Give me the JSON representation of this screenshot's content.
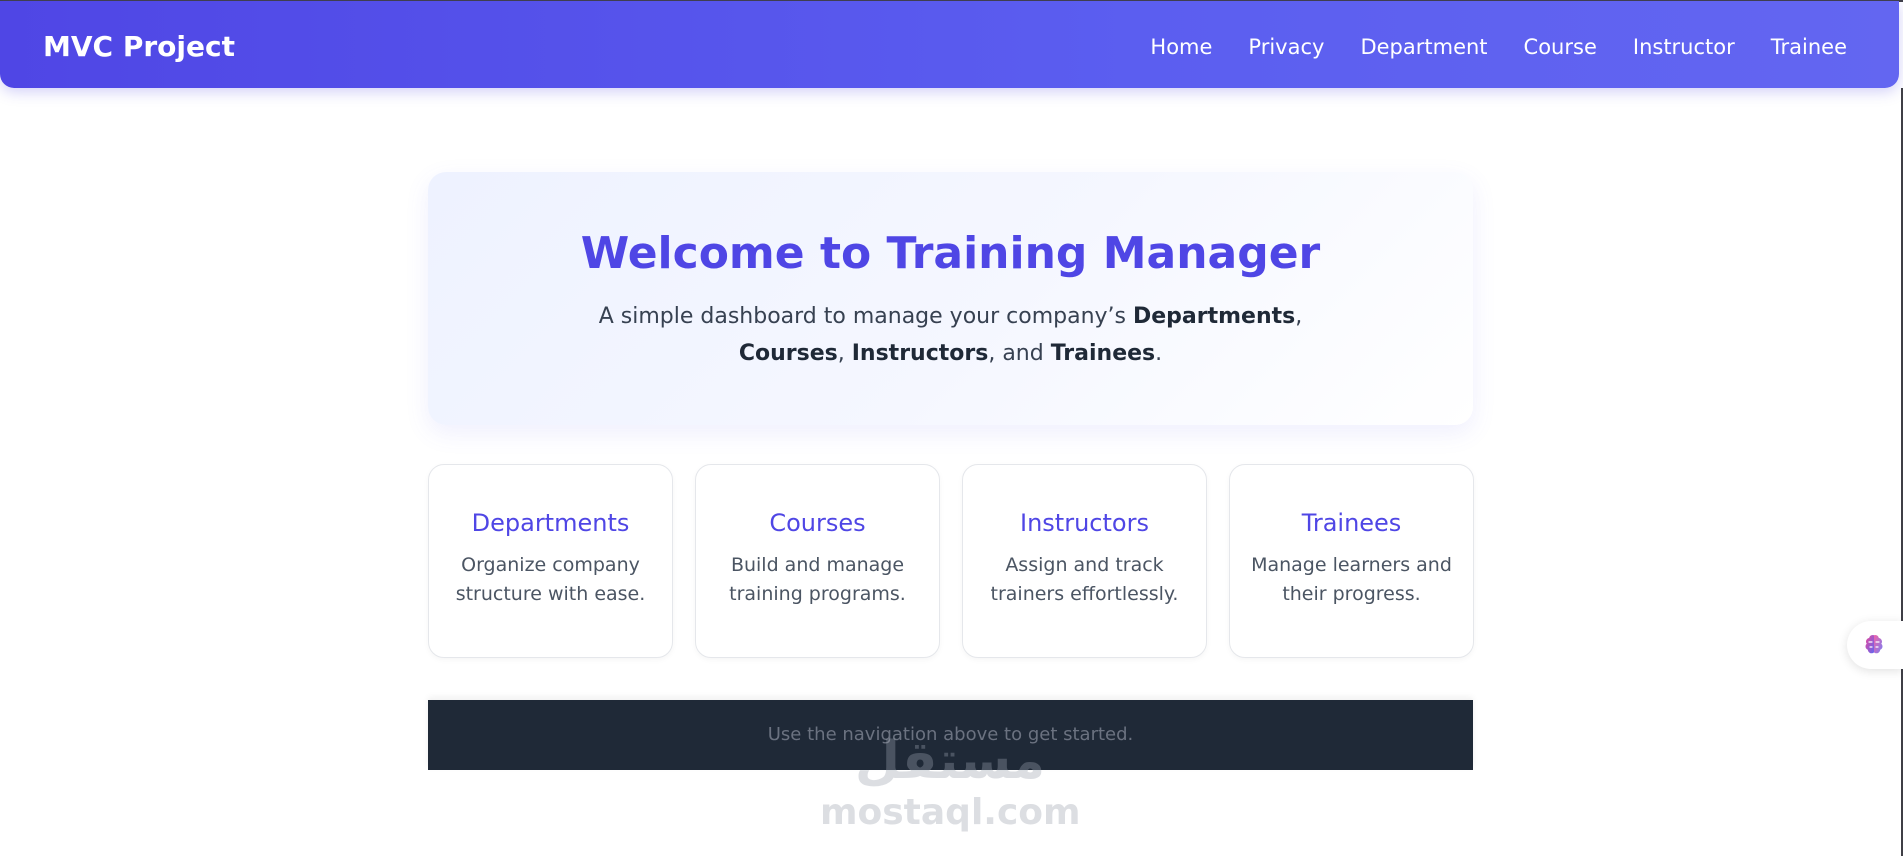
{
  "navbar": {
    "brand": "MVC Project",
    "links": [
      "Home",
      "Privacy",
      "Department",
      "Course",
      "Instructor",
      "Trainee"
    ]
  },
  "hero": {
    "title": "Welcome to Training Manager",
    "text_prefix": "A simple dashboard to manage your company’s ",
    "departments": "Departments",
    "sep1": ", ",
    "courses": "Courses",
    "sep2": ", ",
    "instructors": "Instructors",
    "sep3": ", and ",
    "trainees": "Trainees",
    "suffix": "."
  },
  "cards": [
    {
      "title": "Departments",
      "description": "Organize company structure with ease."
    },
    {
      "title": "Courses",
      "description": "Build and manage training programs."
    },
    {
      "title": "Instructors",
      "description": "Assign and track trainers effortlessly."
    },
    {
      "title": "Trainees",
      "description": "Manage learners and their progress."
    }
  ],
  "footer": {
    "text": "Use the navigation above to get started."
  },
  "side_widget": {
    "icon": "brain-icon"
  },
  "watermark": {
    "arabic": "مستقل",
    "latin": "mostaql.com"
  },
  "colors": {
    "primary": "#4f46e5",
    "footer_bg": "#1f2937"
  }
}
